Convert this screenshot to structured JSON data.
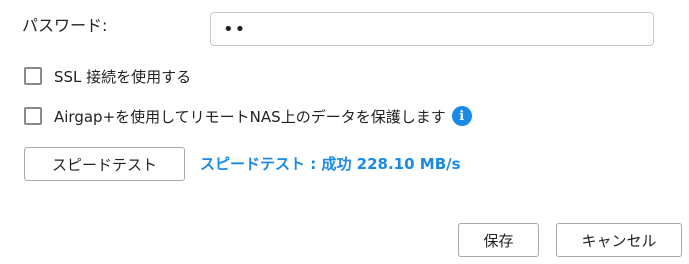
{
  "password": {
    "label": "パスワード:",
    "value": "••"
  },
  "options": {
    "ssl_label": "SSL 接続を使用する",
    "airgap_label": "Airgap+を使用してリモートNAS上のデータを保護します",
    "ssl_checked": false,
    "airgap_checked": false,
    "info_icon_glyph": "i"
  },
  "speedtest": {
    "button_label": "スピードテスト",
    "result_text": "スピードテスト : 成功 228.10 MB/s"
  },
  "footer": {
    "save_label": "保存",
    "cancel_label": "キャンセル"
  },
  "colors": {
    "accent": "#1a8ae6",
    "border": "#a9a9a9"
  }
}
